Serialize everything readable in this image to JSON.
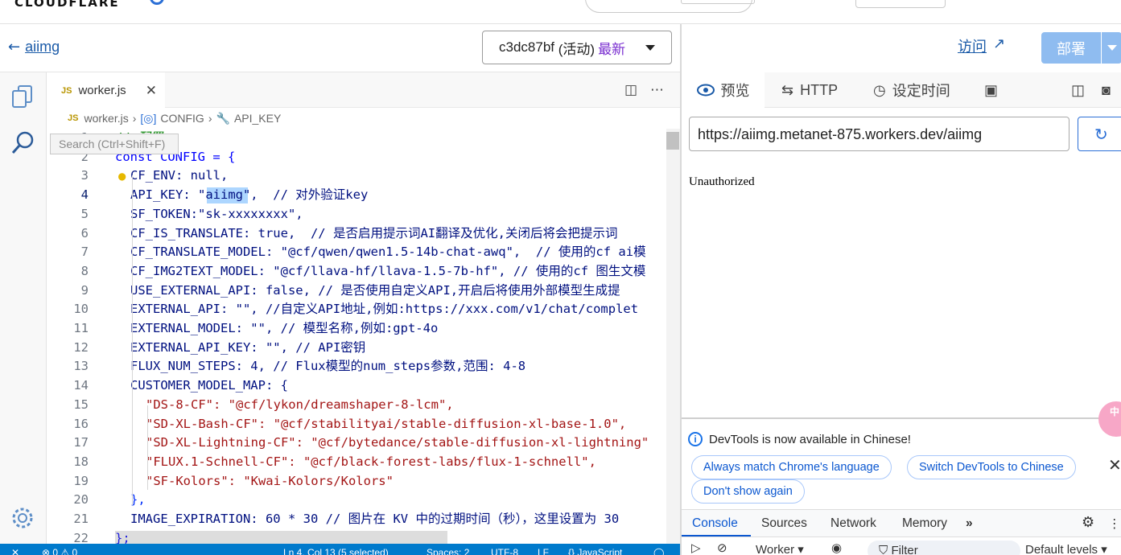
{
  "brand": {
    "logo_text": "CLOUDFLARE"
  },
  "editor_header": {
    "back_label": "aiimg",
    "version_id": "c3dc87bf",
    "version_status": "(活动)",
    "version_latest": "最新"
  },
  "tabs": {
    "file_tab": "worker.js",
    "js_badge": "JS"
  },
  "breadcrumb": {
    "file": "worker.js",
    "object": "CONFIG",
    "property": "API_KEY"
  },
  "search_tooltip": "Search (Ctrl+Shift+F)",
  "code_lines": [
    {
      "num": "1",
      "text": "// 配置"
    },
    {
      "num": "2",
      "text": "const CONFIG = {"
    },
    {
      "num": "3",
      "text": "CF_ENV: null,"
    },
    {
      "num": "4",
      "text": "API_KEY: \"aiimg\",  // 对外验证key"
    },
    {
      "num": "5",
      "text": "SF_TOKEN:\"sk-xxxxxxxx\","
    },
    {
      "num": "6",
      "text": "CF_IS_TRANSLATE: true,  // 是否启用提示词AI翻译及优化,关闭后将会把提示词"
    },
    {
      "num": "7",
      "text": "CF_TRANSLATE_MODEL: \"@cf/qwen/qwen1.5-14b-chat-awq\",  // 使用的cf ai模"
    },
    {
      "num": "8",
      "text": "CF_IMG2TEXT_MODEL: \"@cf/llava-hf/llava-1.5-7b-hf\", // 使用的cf 图生文模"
    },
    {
      "num": "9",
      "text": "USE_EXTERNAL_API: false, // 是否使用自定义API,开启后将使用外部模型生成提"
    },
    {
      "num": "10",
      "text": "EXTERNAL_API: \"\", //自定义API地址,例如:https://xxx.com/v1/chat/complet"
    },
    {
      "num": "11",
      "text": "EXTERNAL_MODEL: \"\", // 模型名称,例如:gpt-4o"
    },
    {
      "num": "12",
      "text": "EXTERNAL_API_KEY: \"\", // API密钥"
    },
    {
      "num": "13",
      "text": "FLUX_NUM_STEPS: 4, // Flux模型的num_steps参数,范围: 4-8"
    },
    {
      "num": "14",
      "text": "CUSTOMER_MODEL_MAP: {"
    },
    {
      "num": "15",
      "text": "\"DS-8-CF\": \"@cf/lykon/dreamshaper-8-lcm\","
    },
    {
      "num": "16",
      "text": "\"SD-XL-Bash-CF\": \"@cf/stabilityai/stable-diffusion-xl-base-1.0\","
    },
    {
      "num": "17",
      "text": "\"SD-XL-Lightning-CF\": \"@cf/bytedance/stable-diffusion-xl-lightning\""
    },
    {
      "num": "18",
      "text": "\"FLUX.1-Schnell-CF\": \"@cf/black-forest-labs/flux-1-schnell\","
    },
    {
      "num": "19",
      "text": "\"SF-Kolors\": \"Kwai-Kolors/Kolors\""
    },
    {
      "num": "20",
      "text": "},"
    },
    {
      "num": "21",
      "text": "IMAGE_EXPIRATION: 60 * 30 // 图片在 KV 中的过期时间（秒），这里设置为 30"
    },
    {
      "num": "22",
      "text": "};"
    }
  ],
  "status_bar": {
    "problems": "0",
    "warnings": "0",
    "position": "Ln 4, Col 13 (5 selected)",
    "spaces": "Spaces: 2",
    "encoding": "UTF-8",
    "eol": "LF",
    "language": "JavaScript"
  },
  "preview_header": {
    "visit_label": "访问",
    "deploy_label": "部署"
  },
  "preview_tabs": [
    {
      "label": "预览"
    },
    {
      "label": "HTTP"
    },
    {
      "label": "设定时间"
    }
  ],
  "preview": {
    "url": "https://aiimg.metanet-875.workers.dev/aiimg",
    "response_body": "Unauthorized"
  },
  "devtools": {
    "notice": "DevTools is now available in Chinese!",
    "buttons": [
      "Always match Chrome's language",
      "Switch DevTools to Chinese",
      "Don't show again"
    ],
    "tabs": [
      "Console",
      "Sources",
      "Network",
      "Memory"
    ],
    "context": "Worker ▾",
    "filter_placeholder": "Filter",
    "levels": "Default levels ▾"
  },
  "colors": {
    "accent": "#007acc",
    "link": "#1a5aa8",
    "deploy": "#8fbcf0",
    "latest": "#7a2fd0"
  },
  "floating_badge": "中"
}
